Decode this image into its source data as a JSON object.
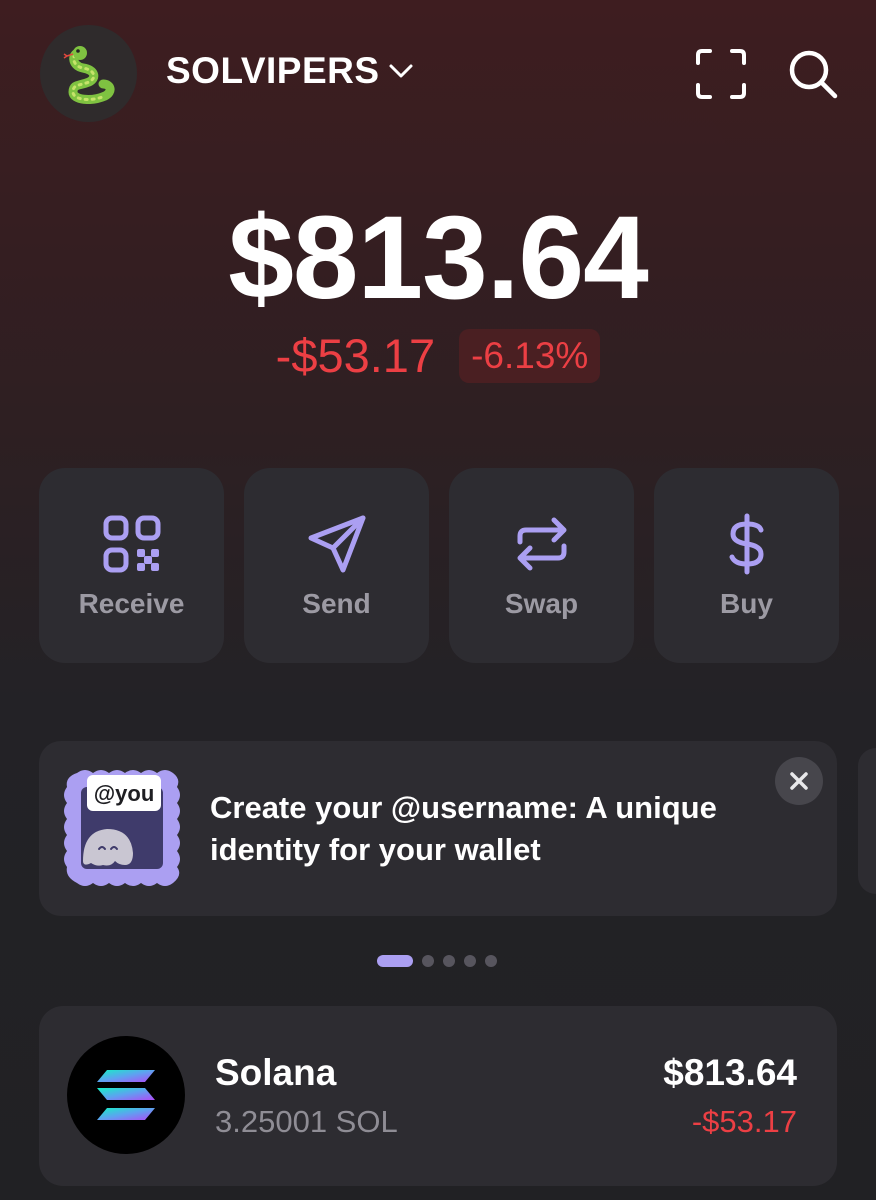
{
  "header": {
    "wallet_name": "SOLVIPERS",
    "avatar_icon": "snake-emoji",
    "dropdown_icon": "chevron-down-icon",
    "scan_icon": "scan-icon",
    "search_icon": "search-icon"
  },
  "balance": {
    "total": "$813.64",
    "change_amount": "-$53.17",
    "change_percent": "-6.13%"
  },
  "actions": [
    {
      "label": "Receive",
      "icon": "qr-code-icon"
    },
    {
      "label": "Send",
      "icon": "send-icon"
    },
    {
      "label": "Swap",
      "icon": "swap-icon"
    },
    {
      "label": "Buy",
      "icon": "dollar-icon"
    }
  ],
  "promo": {
    "badge": "@you",
    "text": "Create your @username: A unique identity for your wallet",
    "close_icon": "close-icon"
  },
  "carousel": {
    "count": 5,
    "active_index": 0
  },
  "tokens": [
    {
      "name": "Solana",
      "amount": "3.25001 SOL",
      "value": "$813.64",
      "change": "-$53.17"
    }
  ],
  "colors": {
    "accent": "#ab9ff2",
    "negative": "#ec3f44",
    "card": "#2d2c31",
    "muted_text": "#9c9aa3"
  }
}
